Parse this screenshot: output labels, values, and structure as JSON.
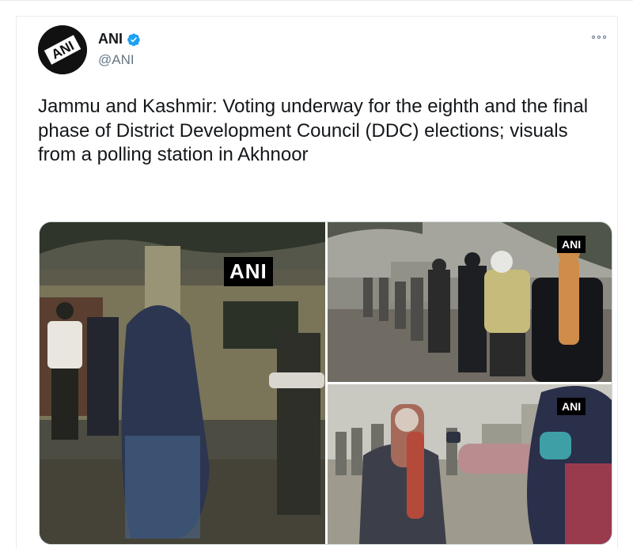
{
  "tweet": {
    "author_name": "ANI",
    "author_handle": "@ANI",
    "avatar_text": "ANI",
    "text": "Jammu and Kashmir: Voting underway for the eighth and the final phase of District Development Council (DDC) elections; visuals from a polling station in Akhnoor"
  },
  "media": {
    "watermark_1": "ANI",
    "watermark_2": "ANI",
    "watermark_3": "ANI"
  },
  "colors": {
    "verified": "#1da1f2",
    "text_primary": "#14171a",
    "text_secondary": "#657786"
  },
  "icons": {
    "verified": "verified-badge-icon",
    "more": "more-options-icon"
  }
}
